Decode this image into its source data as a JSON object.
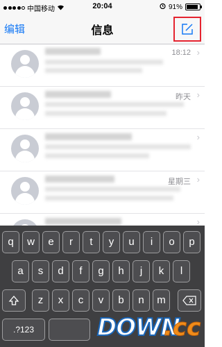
{
  "status_bar": {
    "carrier": "中国移动",
    "time": "20:04",
    "battery_percent": "91%",
    "battery_level": 0.91
  },
  "nav": {
    "edit_label": "编辑",
    "title": "信息",
    "compose_icon": "compose-icon"
  },
  "messages": [
    {
      "time": "18:12"
    },
    {
      "time": "昨天"
    },
    {
      "time": ""
    },
    {
      "time": "星期三"
    },
    {
      "time": ""
    }
  ],
  "keyboard": {
    "row1": [
      "q",
      "w",
      "e",
      "r",
      "t",
      "y",
      "u",
      "i",
      "o",
      "p"
    ],
    "row2": [
      "a",
      "s",
      "d",
      "f",
      "g",
      "h",
      "j",
      "k",
      "l"
    ],
    "row3": [
      "z",
      "x",
      "c",
      "v",
      "b",
      "n",
      "m"
    ],
    "numbers_key": ".?123",
    "shift_icon": "shift-icon",
    "delete_icon": "delete-icon"
  },
  "watermark": {
    "text1": "DOWN",
    "text2": ".cc",
    "color_blue": "#1a66b8",
    "color_orange": "#f08c1a"
  }
}
